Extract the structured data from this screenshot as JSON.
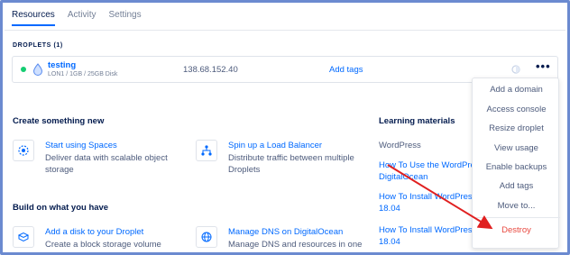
{
  "tabs": [
    {
      "label": "Resources",
      "active": true
    },
    {
      "label": "Activity",
      "active": false
    },
    {
      "label": "Settings",
      "active": false
    }
  ],
  "droplets_section": {
    "label": "DROPLETS (1)"
  },
  "droplet": {
    "name": "testing",
    "spec": "LON1 / 1GB / 25GB Disk",
    "ip": "138.68.152.40",
    "add_tags": "Add tags",
    "more": "•••"
  },
  "create": {
    "heading": "Create something new",
    "items": [
      {
        "title": "Start using Spaces",
        "desc_line1": "Deliver data with scalable object",
        "desc_line2": "storage"
      },
      {
        "title": "Spin up a Load Balancer",
        "desc_line1": "Distribute traffic between multiple",
        "desc_line2": "Droplets"
      }
    ]
  },
  "build": {
    "heading": "Build on what you have",
    "items": [
      {
        "title": "Add a disk to your Droplet",
        "desc_line1": "Create a block storage volume"
      },
      {
        "title": "Manage DNS on DigitalOcean",
        "desc_line1": "Manage DNS and resources in one"
      }
    ]
  },
  "learning": {
    "heading": "Learning materials",
    "category": "WordPress",
    "links": [
      {
        "line1": "How To Use the WordPres",
        "line2": "DigitalOcean"
      },
      {
        "line1": "How To Install WordPress",
        "line2": "18.04"
      },
      {
        "line1": "How To Install WordPress",
        "line2": "18.04"
      }
    ]
  },
  "context_menu": {
    "items": [
      "Add a domain",
      "Access console",
      "Resize droplet",
      "View usage",
      "Enable backups",
      "Add tags",
      "Move to..."
    ],
    "destroy": "Destroy"
  },
  "colors": {
    "accent": "#0069ff",
    "danger": "#e8483f",
    "status_active": "#15cd72",
    "annotation_arrow": "#e02020",
    "frame_border": "#6b8ad0"
  }
}
